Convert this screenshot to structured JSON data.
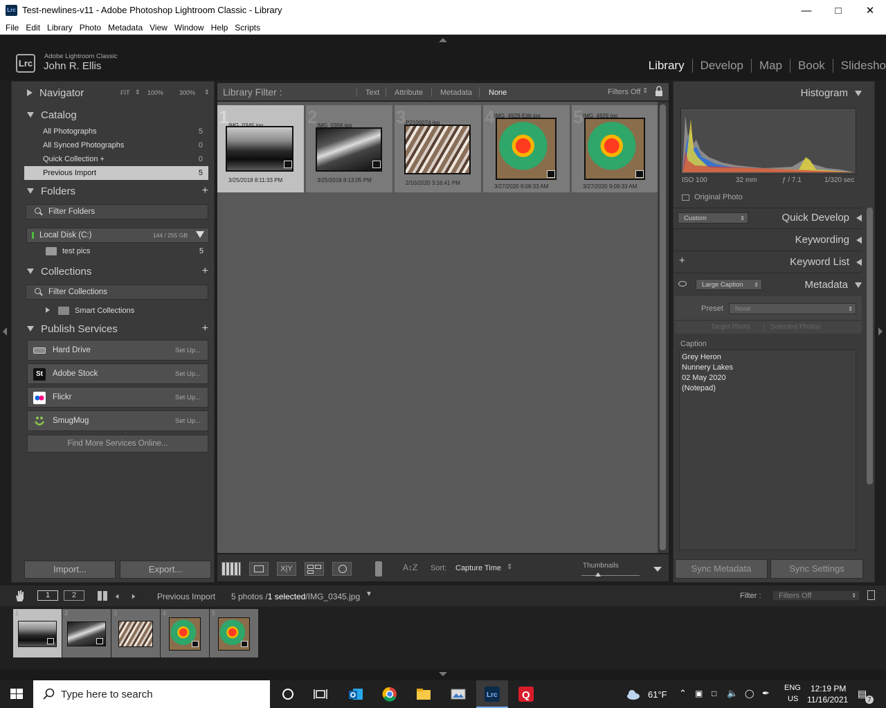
{
  "window": {
    "title": "Test-newlines-v11 - Adobe Photoshop Lightroom Classic - Library",
    "app_icon": "Lrc"
  },
  "menu": [
    "File",
    "Edit",
    "Library",
    "Photo",
    "Metadata",
    "View",
    "Window",
    "Help",
    "Scripts"
  ],
  "identity": {
    "badge": "Lrc",
    "product": "Adobe Lightroom Classic",
    "user": "John R. Ellis"
  },
  "modules": [
    {
      "label": "Library",
      "active": true
    },
    {
      "label": "Develop",
      "active": false
    },
    {
      "label": "Map",
      "active": false
    },
    {
      "label": "Book",
      "active": false
    },
    {
      "label": "Slidesho",
      "active": false
    }
  ],
  "left": {
    "navigator": {
      "title": "Navigator",
      "fit": "FIT",
      "z100": "100%",
      "z300": "300%"
    },
    "catalog": {
      "title": "Catalog",
      "items": [
        {
          "label": "All Photographs",
          "count": "5",
          "selected": false
        },
        {
          "label": "All Synced Photographs",
          "count": "0",
          "selected": false
        },
        {
          "label": "Quick Collection +",
          "count": "0",
          "selected": false
        },
        {
          "label": "Previous Import",
          "count": "5",
          "selected": true
        }
      ]
    },
    "folders": {
      "title": "Folders",
      "filter_placeholder": "Filter Folders",
      "disk_label": "Local Disk (C:)",
      "disk_size": "144 / 255 GB",
      "folder_name": "test pics",
      "folder_count": "5"
    },
    "collections": {
      "title": "Collections",
      "filter_placeholder": "Filter Collections",
      "smart": "Smart Collections"
    },
    "publish": {
      "title": "Publish Services",
      "services": [
        {
          "label": "Hard Drive",
          "setup": "Set Up..."
        },
        {
          "label": "Adobe Stock",
          "setup": "Set Up...",
          "icon": "St"
        },
        {
          "label": "Flickr",
          "setup": "Set Up..."
        },
        {
          "label": "SmugMug",
          "setup": "Set Up..."
        }
      ],
      "find_more": "Find More Services Online..."
    },
    "import_label": "Import...",
    "export_label": "Export..."
  },
  "filterbar": {
    "title": "Library Filter :",
    "text": "Text",
    "attribute": "Attribute",
    "metadata": "Metadata",
    "none": "None",
    "filters_off": "Filters Off"
  },
  "grid": [
    {
      "num": "1",
      "name": "IMG_0345.jpg",
      "date": "3/25/2018 8:11:33 PM",
      "selected": true,
      "kind": "landscape"
    },
    {
      "num": "2",
      "name": "IMG_0356.jpg",
      "date": "3/25/2018 8:13:05 PM",
      "selected": false,
      "kind": "landscape"
    },
    {
      "num": "3",
      "name": "P2100074.jpg",
      "date": "2/10/2020 3:16:41 PM",
      "selected": false,
      "kind": "market"
    },
    {
      "num": "4",
      "name": "IMG_4929-Edit.jpg",
      "date": "3/27/2020 9:09:33 AM",
      "selected": false,
      "kind": "ball"
    },
    {
      "num": "5",
      "name": "IMG_4929.jpg",
      "date": "3/27/2020 9:09:33 AM",
      "selected": false,
      "kind": "ball"
    }
  ],
  "toolbar": {
    "sort_label": "Sort:",
    "sort_value": "Capture Time",
    "thumbnails_label": "Thumbnails"
  },
  "right": {
    "histogram": {
      "title": "Histogram",
      "iso": "ISO 100",
      "focal": "32 mm",
      "aperture": "ƒ / 7.1",
      "shutter": "1/320 sec",
      "original": "Original Photo"
    },
    "quick_develop": {
      "title": "Quick Develop",
      "preset": "Custom"
    },
    "keywording": "Keywording",
    "keyword_list": "Keyword List",
    "metadata": {
      "title": "Metadata",
      "view": "Large Caption",
      "preset_label": "Preset",
      "preset_value": "None",
      "target_photo": "Target Photo",
      "selected_photos": "Selected Photos",
      "caption_label": "Caption",
      "caption_lines": [
        "Grey Heron",
        "Nunnery Lakes",
        "02 May 2020",
        "(Notepad)"
      ]
    },
    "sync_metadata": "Sync Metadata",
    "sync_settings": "Sync Settings"
  },
  "filmnav": {
    "page1": "1",
    "page2": "2",
    "source": "Previous Import",
    "count_prefix": "5 photos /",
    "selected": "1 selected",
    "current": "/IMG_0345.jpg",
    "filter_label": "Filter :",
    "filter_value": "Filters Off"
  },
  "filmstrip": [
    {
      "num": "1",
      "kind": "landscape",
      "selected": true
    },
    {
      "num": "2",
      "kind": "landscape",
      "selected": false
    },
    {
      "num": "3",
      "kind": "market",
      "selected": false
    },
    {
      "num": "4",
      "kind": "ball",
      "selected": false
    },
    {
      "num": "5",
      "kind": "ball",
      "selected": false
    }
  ],
  "taskbar": {
    "search_placeholder": "Type here to search",
    "weather": "61°F",
    "lang1": "ENG",
    "lang2": "US",
    "time": "12:19 PM",
    "date": "11/16/2021",
    "notif_count": "7"
  }
}
